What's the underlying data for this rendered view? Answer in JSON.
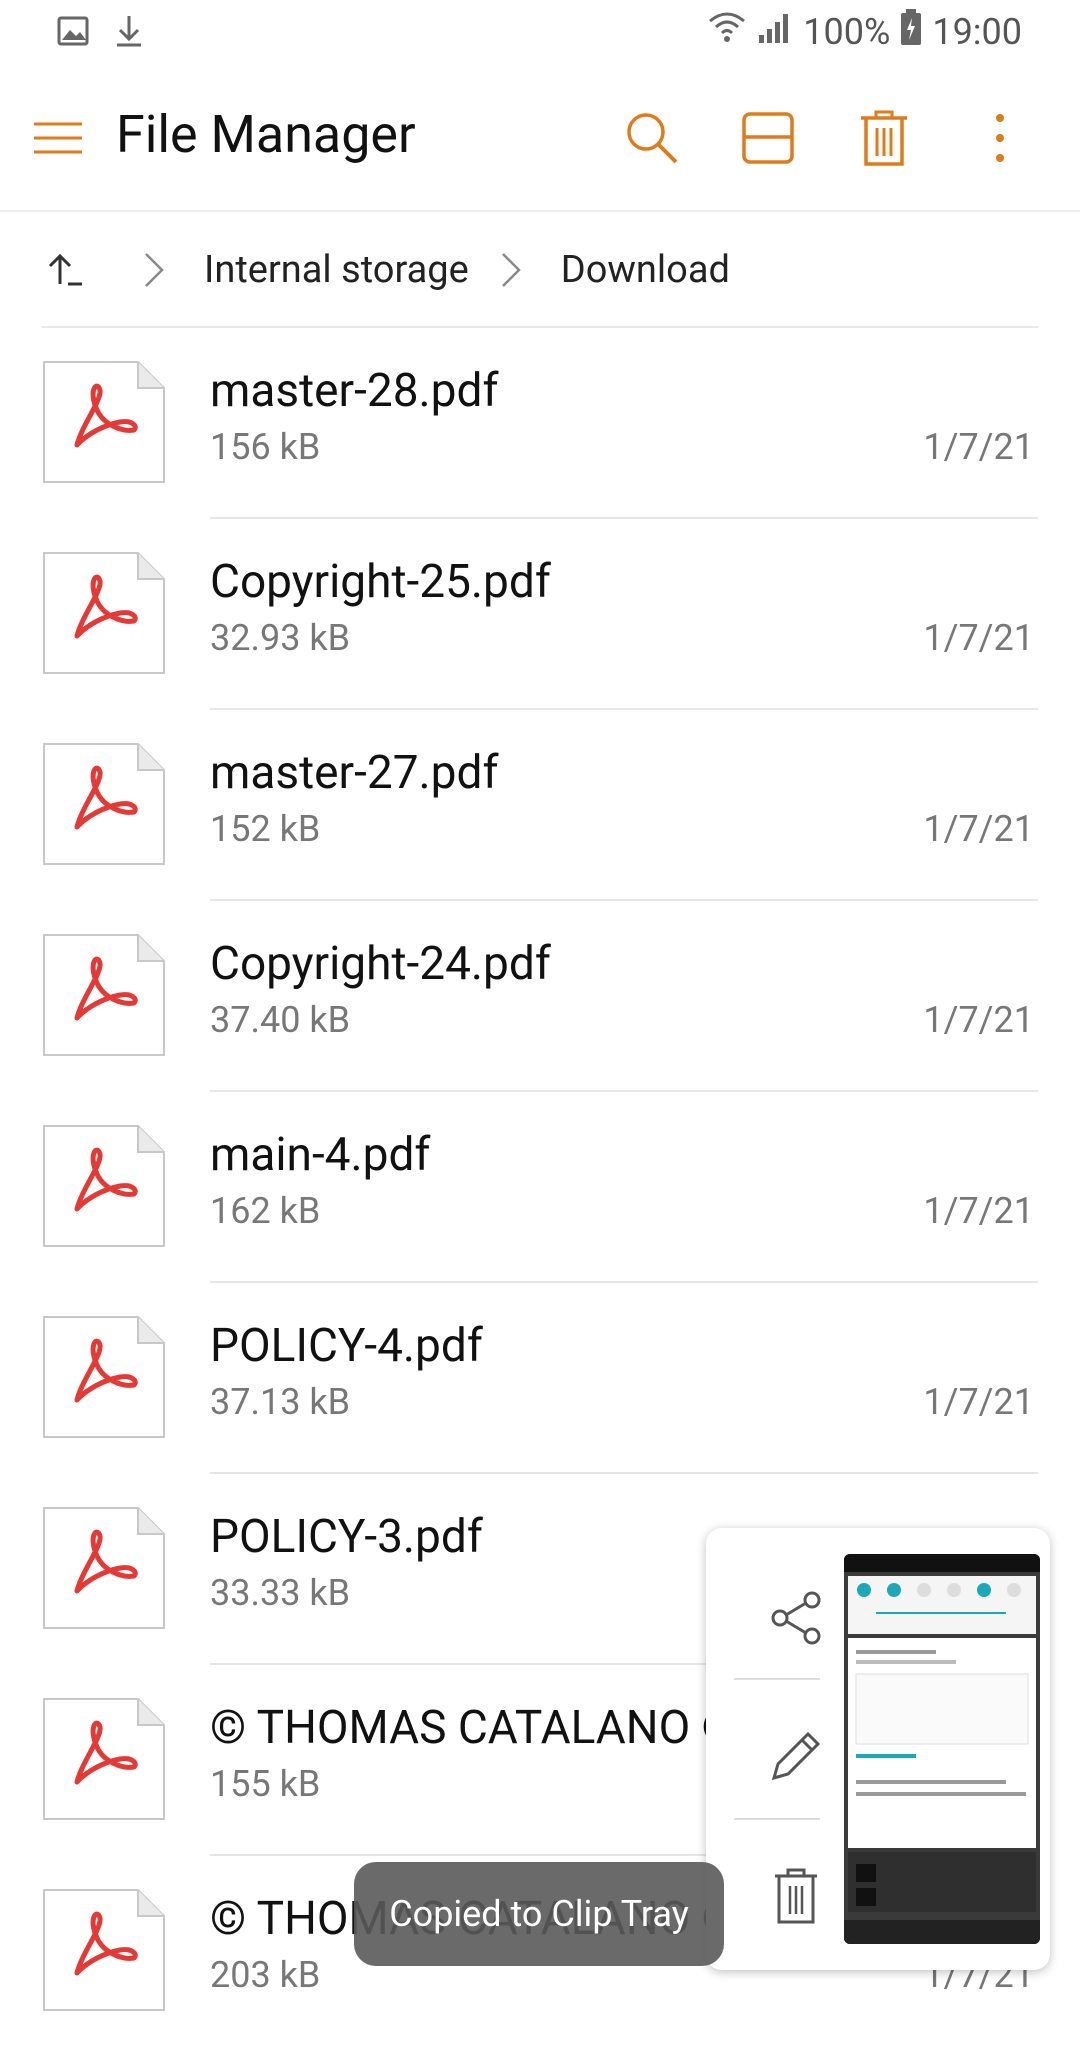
{
  "status_bar": {
    "battery": "100%",
    "time": "19:00",
    "left_icons": [
      "image-icon",
      "download-icon"
    ],
    "right_icons": [
      "wifi-icon",
      "signal-icon",
      "battery-icon"
    ]
  },
  "header": {
    "title": "File Manager",
    "accent_color": "#E07B1A"
  },
  "breadcrumb": {
    "items": [
      "Internal storage",
      "Download"
    ]
  },
  "files": [
    {
      "name": "master-28.pdf",
      "size": "156 kB",
      "date": "1/7/21"
    },
    {
      "name": "Copyright-25.pdf",
      "size": "32.93 kB",
      "date": "1/7/21"
    },
    {
      "name": "master-27.pdf",
      "size": "152 kB",
      "date": "1/7/21"
    },
    {
      "name": "Copyright-24.pdf",
      "size": "37.40 kB",
      "date": "1/7/21"
    },
    {
      "name": "main-4.pdf",
      "size": "162 kB",
      "date": "1/7/21"
    },
    {
      "name": "POLICY-4.pdf",
      "size": "37.13 kB",
      "date": "1/7/21"
    },
    {
      "name": "POLICY-3.pdf",
      "size": "33.33 kB",
      "date": ""
    },
    {
      "name": "© THOMAS CATALANO ©",
      "size": "155 kB",
      "date": ""
    },
    {
      "name": "© THOMAS CATALANO ©",
      "size": "203 kB",
      "date": "1/7/21"
    }
  ],
  "toast": {
    "text": "Copied to Clip Tray"
  },
  "clip_tray": {
    "actions": [
      "share-icon",
      "edit-icon",
      "delete-icon"
    ]
  }
}
